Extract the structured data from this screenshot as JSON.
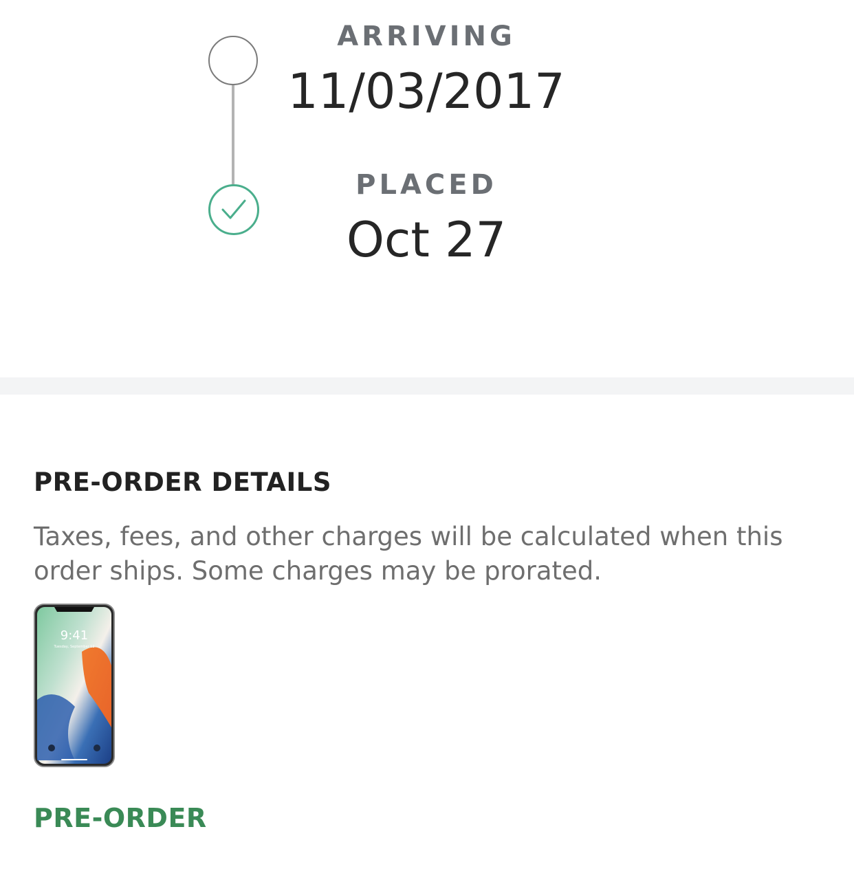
{
  "timeline": {
    "arriving": {
      "label": "ARRIVING",
      "date": "11/03/2017"
    },
    "placed": {
      "label": "PLACED",
      "date": "Oct 27"
    },
    "completed_step_icon": "check-icon",
    "pending_step_icon": "empty-circle-icon",
    "colors": {
      "done": "#4aae8c",
      "pending": "#7a7a7a",
      "line": "#b3b3b3"
    }
  },
  "details": {
    "title": "PRE-ORDER DETAILS",
    "description": "Taxes, fees, and other charges will be calculated when this order ships. Some charges may be prorated."
  },
  "product": {
    "image_icon": "phone-image",
    "screen_time": "9:41",
    "screen_date": "Tuesday, September 12",
    "badge": "PRE-ORDER",
    "badge_color": "#3a8a56"
  }
}
